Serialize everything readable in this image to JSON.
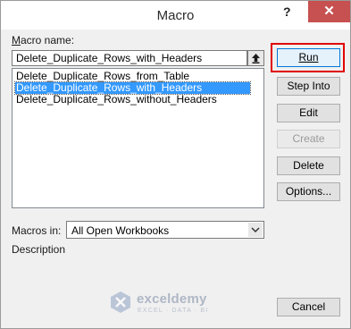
{
  "window": {
    "title": "Macro",
    "help": "?",
    "close": "✕"
  },
  "macro_name": {
    "label": "Macro name:",
    "value": "Delete_Duplicate_Rows_with_Headers"
  },
  "macros": [
    {
      "label": "Delete_Duplicate_Rows_from_Table",
      "selected": false
    },
    {
      "label": "Delete_Duplicate_Rows_with_Headers",
      "selected": true
    },
    {
      "label": "Delete_Duplicate_Rows_without_Headers",
      "selected": false
    }
  ],
  "buttons": {
    "run": "Run",
    "step_into": "Step Into",
    "edit": "Edit",
    "create": "Create",
    "delete": "Delete",
    "options": "Options...",
    "cancel": "Cancel"
  },
  "macros_in": {
    "label": "Macros in:",
    "value": "All Open Workbooks"
  },
  "description": {
    "label": "Description",
    "text": ""
  },
  "watermark": {
    "name": "exceldemy",
    "tagline": "EXCEL · DATA · BI"
  },
  "colors": {
    "highlight": "#e00000",
    "selection": "#3399ff",
    "close": "#c75050"
  }
}
